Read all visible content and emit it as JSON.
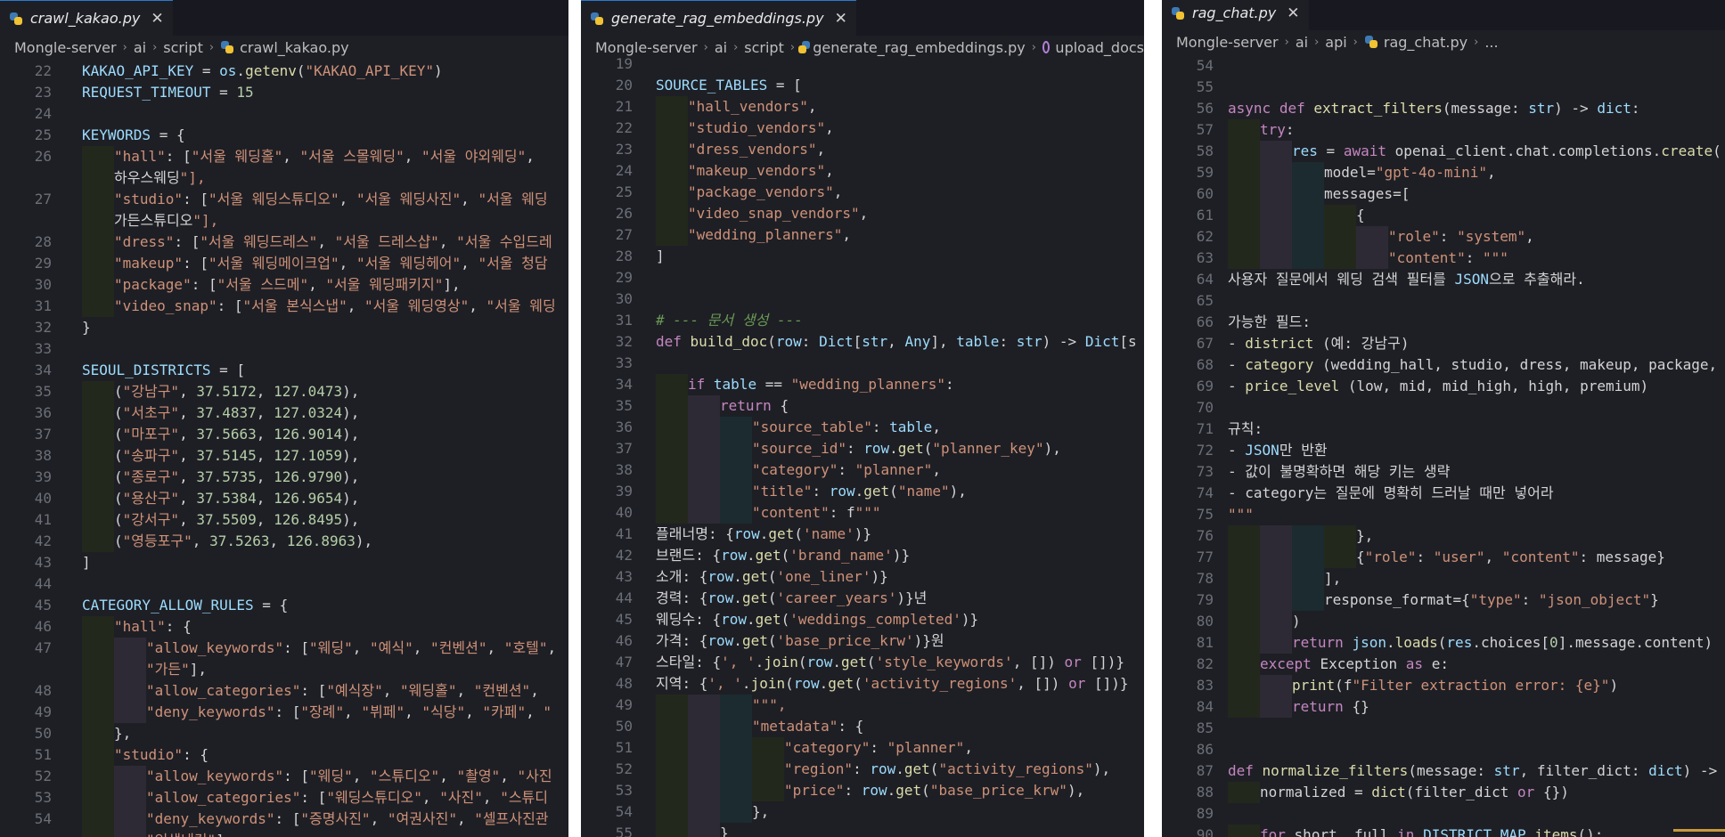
{
  "panels": [
    {
      "tab": "crawl_kakao.py",
      "crumbs": [
        "Mongle-server",
        "ai",
        "script",
        "crawl_kakao.py"
      ],
      "symbol": "",
      "lines": [
        {
          "n": "22",
          "t": "KAKAO_API_KEY = os.getenv(\"KAKAO_API_KEY\")",
          "i": 0
        },
        {
          "n": "23",
          "t": "REQUEST_TIMEOUT = 15",
          "i": 0
        },
        {
          "n": "24",
          "t": "",
          "i": 0
        },
        {
          "n": "25",
          "t": "KEYWORDS = {",
          "i": 0
        },
        {
          "n": "26",
          "t": "    \"hall\": [\"서울 웨딩홀\", \"서울 스몰웨딩\", \"서울 야외웨딩\",",
          "i": 1
        },
        {
          "n": "",
          "t": "    하우스웨딩\"],",
          "i": 1
        },
        {
          "n": "27",
          "t": "    \"studio\": [\"서울 웨딩스튜디오\", \"서울 웨딩사진\", \"서울 웨딩",
          "i": 1
        },
        {
          "n": "",
          "t": "    가든스튜디오\"],",
          "i": 1
        },
        {
          "n": "28",
          "t": "    \"dress\": [\"서울 웨딩드레스\", \"서울 드레스샵\", \"서울 수입드레",
          "i": 1
        },
        {
          "n": "29",
          "t": "    \"makeup\": [\"서울 웨딩메이크업\", \"서울 웨딩헤어\", \"서울 청담",
          "i": 1
        },
        {
          "n": "30",
          "t": "    \"package\": [\"서울 스드메\", \"서울 웨딩패키지\"],",
          "i": 1
        },
        {
          "n": "31",
          "t": "    \"video_snap\": [\"서울 본식스냅\", \"서울 웨딩영상\", \"서울 웨딩",
          "i": 1
        },
        {
          "n": "32",
          "t": "}",
          "i": 0
        },
        {
          "n": "33",
          "t": "",
          "i": 0
        },
        {
          "n": "34",
          "t": "SEOUL_DISTRICTS = [",
          "i": 0
        },
        {
          "n": "35",
          "t": "    (\"강남구\", 37.5172, 127.0473),",
          "i": 1
        },
        {
          "n": "36",
          "t": "    (\"서초구\", 37.4837, 127.0324),",
          "i": 1
        },
        {
          "n": "37",
          "t": "    (\"마포구\", 37.5663, 126.9014),",
          "i": 1
        },
        {
          "n": "38",
          "t": "    (\"송파구\", 37.5145, 127.1059),",
          "i": 1
        },
        {
          "n": "39",
          "t": "    (\"종로구\", 37.5735, 126.9790),",
          "i": 1
        },
        {
          "n": "40",
          "t": "    (\"용산구\", 37.5384, 126.9654),",
          "i": 1
        },
        {
          "n": "41",
          "t": "    (\"강서구\", 37.5509, 126.8495),",
          "i": 1
        },
        {
          "n": "42",
          "t": "    (\"영등포구\", 37.5263, 126.8963),",
          "i": 1
        },
        {
          "n": "43",
          "t": "]",
          "i": 0
        },
        {
          "n": "44",
          "t": "",
          "i": 0
        },
        {
          "n": "45",
          "t": "CATEGORY_ALLOW_RULES = {",
          "i": 0
        },
        {
          "n": "46",
          "t": "    \"hall\": {",
          "i": 1
        },
        {
          "n": "47",
          "t": "        \"allow_keywords\": [\"웨딩\", \"예식\", \"컨벤션\", \"호텔\",",
          "i": 2
        },
        {
          "n": "",
          "t": "        \"가든\"],",
          "i": 2
        },
        {
          "n": "48",
          "t": "        \"allow_categories\": [\"예식장\", \"웨딩홀\", \"컨벤션\",",
          "i": 2
        },
        {
          "n": "49",
          "t": "        \"deny_keywords\": [\"장례\", \"뷔페\", \"식당\", \"카페\", \"",
          "i": 2
        },
        {
          "n": "50",
          "t": "    },",
          "i": 1
        },
        {
          "n": "51",
          "t": "    \"studio\": {",
          "i": 1
        },
        {
          "n": "52",
          "t": "        \"allow_keywords\": [\"웨딩\", \"스튜디오\", \"촬영\", \"사진",
          "i": 2
        },
        {
          "n": "53",
          "t": "        \"allow_categories\": [\"웨딩스튜디오\", \"사진\", \"스튜디",
          "i": 2
        },
        {
          "n": "54",
          "t": "        \"deny_keywords\": [\"증명사진\", \"여권사진\", \"셀프사진관",
          "i": 2
        },
        {
          "n": "",
          "t": "        \"인생네컷\"],",
          "i": 2
        }
      ]
    },
    {
      "tab": "generate_rag_embeddings.py",
      "crumbs": [
        "Mongle-server",
        "ai",
        "script",
        "generate_rag_embeddings.py"
      ],
      "symbol": "upload_docs",
      "lines": [
        {
          "n": "19",
          "t": "",
          "i": 0
        },
        {
          "n": "20",
          "t": "SOURCE_TABLES = [",
          "i": 0
        },
        {
          "n": "21",
          "t": "    \"hall_vendors\",",
          "i": 1
        },
        {
          "n": "22",
          "t": "    \"studio_vendors\",",
          "i": 1
        },
        {
          "n": "23",
          "t": "    \"dress_vendors\",",
          "i": 1
        },
        {
          "n": "24",
          "t": "    \"makeup_vendors\",",
          "i": 1
        },
        {
          "n": "25",
          "t": "    \"package_vendors\",",
          "i": 1
        },
        {
          "n": "26",
          "t": "    \"video_snap_vendors\",",
          "i": 1
        },
        {
          "n": "27",
          "t": "    \"wedding_planners\",",
          "i": 1
        },
        {
          "n": "28",
          "t": "]",
          "i": 0
        },
        {
          "n": "29",
          "t": "",
          "i": 0
        },
        {
          "n": "30",
          "t": "",
          "i": 0
        },
        {
          "n": "31",
          "t": "# --- 문서 생성 ---",
          "i": 0
        },
        {
          "n": "32",
          "t": "def build_doc(row: Dict[str, Any], table: str) -> Dict[s",
          "i": 0
        },
        {
          "n": "33",
          "t": "",
          "i": 0
        },
        {
          "n": "34",
          "t": "    if table == \"wedding_planners\":",
          "i": 1
        },
        {
          "n": "35",
          "t": "        return {",
          "i": 2
        },
        {
          "n": "36",
          "t": "            \"source_table\": table,",
          "i": 3
        },
        {
          "n": "37",
          "t": "            \"source_id\": row.get(\"planner_key\"),",
          "i": 3
        },
        {
          "n": "38",
          "t": "            \"category\": \"planner\",",
          "i": 3
        },
        {
          "n": "39",
          "t": "            \"title\": row.get(\"name\"),",
          "i": 3
        },
        {
          "n": "40",
          "t": "            \"content\": f\"\"\"",
          "i": 3
        },
        {
          "n": "41",
          "t": "플래너명: {row.get('name')}",
          "i": 0
        },
        {
          "n": "42",
          "t": "브랜드: {row.get('brand_name')}",
          "i": 0
        },
        {
          "n": "43",
          "t": "소개: {row.get('one_liner')}",
          "i": 0
        },
        {
          "n": "44",
          "t": "경력: {row.get('career_years')}년",
          "i": 0
        },
        {
          "n": "45",
          "t": "웨딩수: {row.get('weddings_completed')}",
          "i": 0
        },
        {
          "n": "46",
          "t": "가격: {row.get('base_price_krw')}원",
          "i": 0
        },
        {
          "n": "47",
          "t": "스타일: {', '.join(row.get('style_keywords', []) or [])}",
          "i": 0
        },
        {
          "n": "48",
          "t": "지역: {', '.join(row.get('activity_regions', []) or [])}",
          "i": 0
        },
        {
          "n": "49",
          "t": "            \"\"\",",
          "i": 3
        },
        {
          "n": "50",
          "t": "            \"metadata\": {",
          "i": 3
        },
        {
          "n": "51",
          "t": "                \"category\": \"planner\",",
          "i": 4
        },
        {
          "n": "52",
          "t": "                \"region\": row.get(\"activity_regions\"),",
          "i": 4
        },
        {
          "n": "53",
          "t": "                \"price\": row.get(\"base_price_krw\"),",
          "i": 4
        },
        {
          "n": "54",
          "t": "            },",
          "i": 3
        },
        {
          "n": "55",
          "t": "        }",
          "i": 2
        }
      ]
    },
    {
      "tab": "rag_chat.py",
      "crumbs": [
        "Mongle-server",
        "ai",
        "api",
        "rag_chat.py",
        "..."
      ],
      "symbol": "",
      "lines": [
        {
          "n": "54",
          "t": "",
          "i": 0
        },
        {
          "n": "55",
          "t": "",
          "i": 0
        },
        {
          "n": "56",
          "t": "async def extract_filters(message: str) -> dict:",
          "i": 0
        },
        {
          "n": "57",
          "t": "    try:",
          "i": 1
        },
        {
          "n": "58",
          "t": "        res = await openai_client.chat.completions.create(",
          "i": 2
        },
        {
          "n": "59",
          "t": "            model=\"gpt-4o-mini\",",
          "i": 3
        },
        {
          "n": "60",
          "t": "            messages=[",
          "i": 3
        },
        {
          "n": "61",
          "t": "                {",
          "i": 4
        },
        {
          "n": "62",
          "t": "                    \"role\": \"system\",",
          "i": 5
        },
        {
          "n": "63",
          "t": "                    \"content\": \"\"\"",
          "i": 5
        },
        {
          "n": "64",
          "t": "사용자 질문에서 웨딩 검색 필터를 JSON으로 추출해라.",
          "i": 0
        },
        {
          "n": "65",
          "t": "",
          "i": 0
        },
        {
          "n": "66",
          "t": "가능한 필드:",
          "i": 0
        },
        {
          "n": "67",
          "t": "- district (예: 강남구)",
          "i": 0
        },
        {
          "n": "68",
          "t": "- category (wedding_hall, studio, dress, makeup, package, video",
          "i": 0
        },
        {
          "n": "69",
          "t": "- price_level (low, mid, mid_high, high, premium)",
          "i": 0
        },
        {
          "n": "70",
          "t": "",
          "i": 0
        },
        {
          "n": "71",
          "t": "규칙:",
          "i": 0
        },
        {
          "n": "72",
          "t": "- JSON만 반환",
          "i": 0
        },
        {
          "n": "73",
          "t": "- 값이 불명확하면 해당 키는 생략",
          "i": 0
        },
        {
          "n": "74",
          "t": "- category는 질문에 명확히 드러날 때만 넣어라",
          "i": 0
        },
        {
          "n": "75",
          "t": "\"\"\"",
          "i": 0
        },
        {
          "n": "76",
          "t": "                },",
          "i": 4
        },
        {
          "n": "77",
          "t": "                {\"role\": \"user\", \"content\": message}",
          "i": 4
        },
        {
          "n": "78",
          "t": "            ],",
          "i": 3
        },
        {
          "n": "79",
          "t": "            response_format={\"type\": \"json_object\"}",
          "i": 3
        },
        {
          "n": "80",
          "t": "        )",
          "i": 2
        },
        {
          "n": "81",
          "t": "        return json.loads(res.choices[0].message.content)",
          "i": 2
        },
        {
          "n": "82",
          "t": "    except Exception as e:",
          "i": 1
        },
        {
          "n": "83",
          "t": "        print(f\"Filter extraction error: {e}\")",
          "i": 2
        },
        {
          "n": "84",
          "t": "        return {}",
          "i": 2
        },
        {
          "n": "85",
          "t": "",
          "i": 0
        },
        {
          "n": "86",
          "t": "",
          "i": 0
        },
        {
          "n": "87",
          "t": "def normalize_filters(message: str, filter_dict: dict) -> dict:",
          "i": 0
        },
        {
          "n": "88",
          "t": "    normalized = dict(filter_dict or {})",
          "i": 1
        },
        {
          "n": "89",
          "t": "",
          "i": 0
        },
        {
          "n": "90",
          "t": "    for short, full in DISTRICT_MAP.items():",
          "i": 1
        }
      ]
    }
  ],
  "colors": {
    "editor_bg": "#1e1f25",
    "tab_bar_bg": "#181920",
    "text": "#d4d4d4",
    "keyword": "#c586c0",
    "string": "#ce9178",
    "function": "#dcdcaa",
    "variable": "#9cdcfe",
    "comment": "#6a9955",
    "number": "#b5cea8"
  }
}
